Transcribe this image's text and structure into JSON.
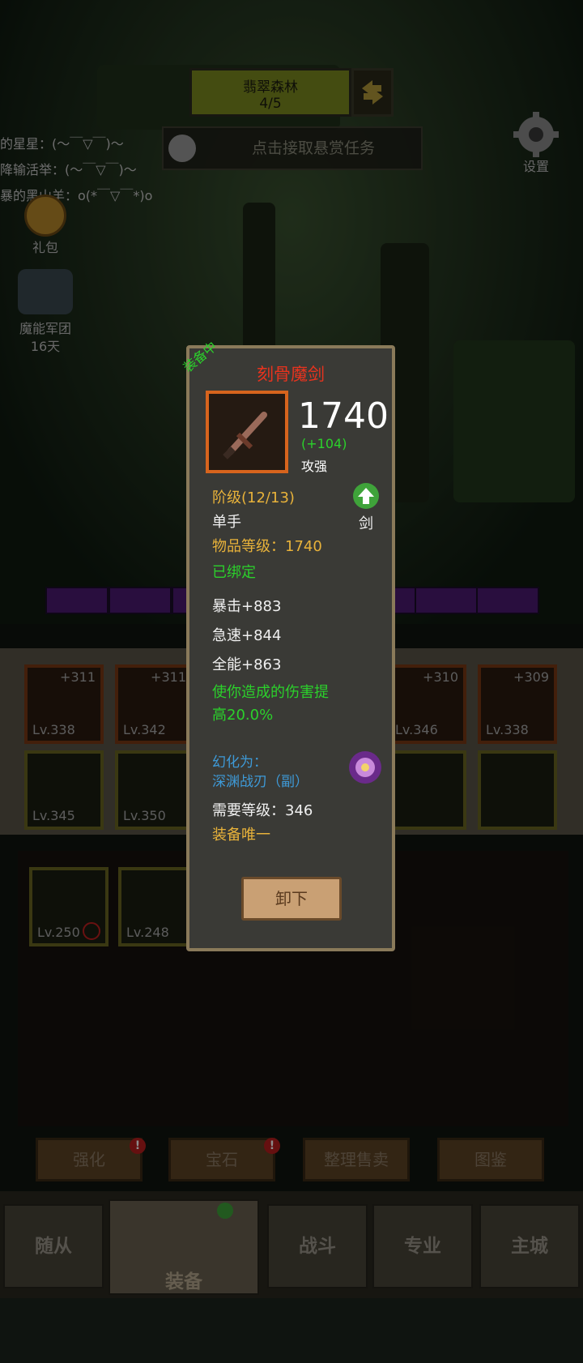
{
  "zone": {
    "name": "翡翠森林",
    "progress": "4/5"
  },
  "quest": {
    "label": "点击接取悬赏任务"
  },
  "chat": [
    "的星星：(～￣▽￣)～",
    "降输活举：(～￣▽￣)～",
    "暴的黑山羊：o(*￣▽￣*)o"
  ],
  "sidebar": {
    "gift": "礼包",
    "legion": "魔能军团",
    "legion_days": "16天",
    "settings": "设置"
  },
  "equip_slots": [
    {
      "plus": "+311",
      "level": "Lv.338"
    },
    {
      "plus": "+311",
      "level": "Lv.342"
    },
    {
      "plus": "+310",
      "level": "Lv.346"
    },
    {
      "plus": "+309",
      "level": "Lv.338"
    }
  ],
  "equip_slots_row2": [
    {
      "level": "Lv.345"
    },
    {
      "level": "Lv.350"
    }
  ],
  "bag_items": [
    {
      "level": "Lv.250"
    },
    {
      "level": "Lv.248"
    }
  ],
  "actions": [
    "强化",
    "宝石",
    "整理售卖",
    "图鉴"
  ],
  "nav": {
    "companions": "随从",
    "equipment": "装备",
    "battle": "战斗",
    "profession": "专业",
    "city": "主城"
  },
  "item": {
    "equipped_tag": "装备中",
    "name": "刻骨魔剑",
    "power": "1740",
    "power_diff": "(+104)",
    "power_note": "攻强",
    "tier": "阶级(12/13)",
    "hand": "单手",
    "item_level": "物品等级：1740",
    "bound": "已绑定",
    "type": "剑",
    "stats": [
      "暴击+883",
      "急速+844",
      "全能+863"
    ],
    "effect_line1": "使你造成的伤害提",
    "effect_line2": "高20.0%",
    "transmog_label": "幻化为：",
    "transmog_name": "深渊战刃（副）",
    "required_level": "需要等级：346",
    "unique": "装备唯一",
    "unequip": "卸下"
  },
  "colors": {
    "item_name": "#e8331e",
    "gold": "#e8b23a",
    "green": "#2bd12b",
    "blue": "#3e9ad8",
    "frame": "#d7641d"
  }
}
